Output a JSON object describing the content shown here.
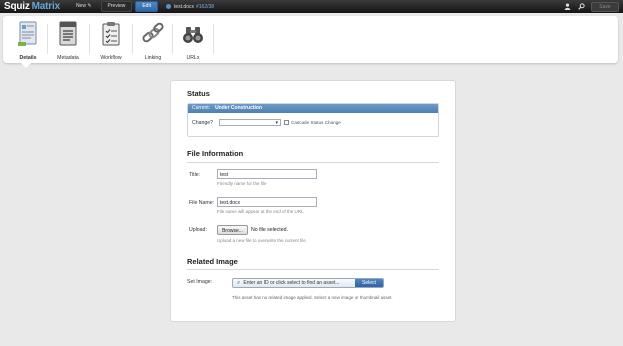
{
  "topbar": {
    "logo_prefix": "Squiz",
    "logo_brand": "Matrix",
    "new_label": "New",
    "preview_label": "Preview",
    "edit_label": "Edit",
    "asset_name": "test.docx",
    "asset_id": "#162/38",
    "save_label": "Save"
  },
  "toolbar": {
    "details": "Details",
    "metadata": "Metadata",
    "workflow": "Workflow",
    "linking": "Linking",
    "urls": "URLs"
  },
  "status": {
    "section_title": "Status",
    "current_label": "Current:",
    "current_value": "Under Construction",
    "change_label": "Change?",
    "cascade_label": "Cascade Status Change"
  },
  "file_info": {
    "section_title": "File Information",
    "title_label": "Title:",
    "title_value": "test",
    "title_hint": "Friendly name for the file",
    "filename_label": "File Name:",
    "filename_value": "test.docx",
    "filename_hint": "File name will appear at the end of the URL",
    "upload_label": "Upload:",
    "browse_label": "Browse...",
    "no_file_label": "No file selected.",
    "upload_hint": "Upload a new file to overwrite the current file"
  },
  "related_image": {
    "section_title": "Related Image",
    "set_image_label": "Set Image:",
    "finder_placeholder": "Enter an ID or click select to find an asset...",
    "select_label": "Select",
    "note": "This asset has no related image applied. Select a new image or thumbnail asset."
  },
  "colors": {
    "edit_blue": "#2f68a8",
    "status_bar": "#5a8cbd",
    "select_blue": "#2f63a3"
  }
}
